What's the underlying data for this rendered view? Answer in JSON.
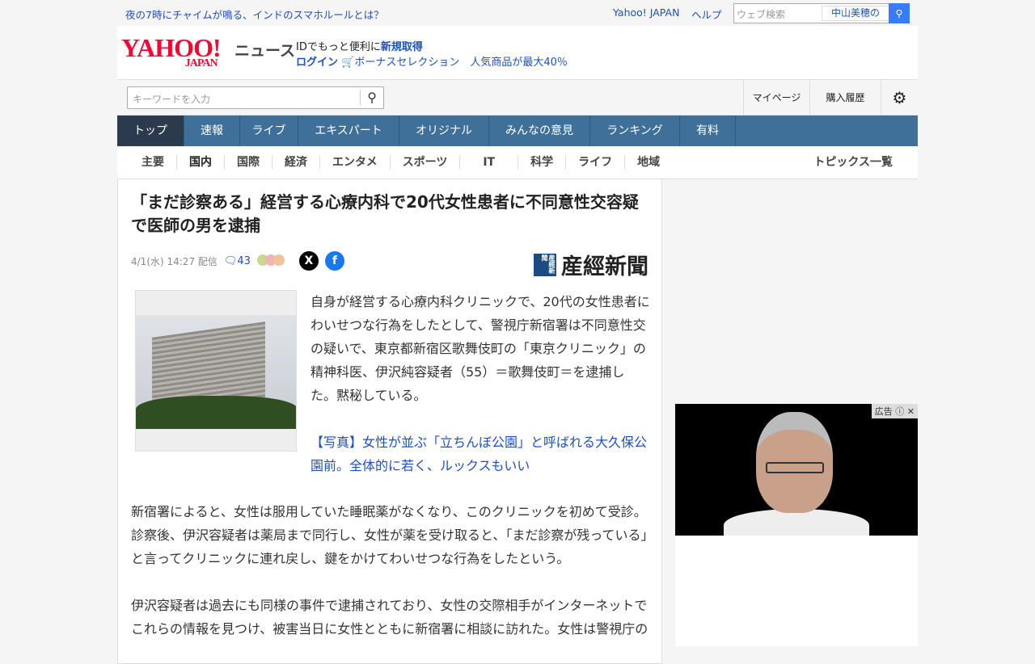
{
  "topbar": {
    "promo": "夜の7時にチャイムが鳴る、インドのスマホルールとは？",
    "yahoo_japan": "Yahoo! JAPAN",
    "help": "ヘルプ",
    "search_placeholder": "ウェブ検索",
    "suggest": "中山美穂の"
  },
  "header": {
    "logo": "YAHOO!",
    "logo_sub": "JAPAN",
    "service": "ニュース",
    "id_text": "IDでもっと便利に",
    "signup": "新規取得",
    "login": "ログイン",
    "promo": "ボーナスセレクション　人気商品が最大40％"
  },
  "searchbar": {
    "placeholder": "キーワードを入力",
    "mypage": "マイページ",
    "history": "購入履歴"
  },
  "nav": [
    "トップ",
    "速報",
    "ライブ",
    "エキスパート",
    "オリジナル",
    "みんなの意見",
    "ランキング",
    "有料"
  ],
  "subnav": [
    "主要",
    "国内",
    "国際",
    "経済",
    "エンタメ",
    "スポーツ",
    "IT",
    "科学",
    "ライフ",
    "地域"
  ],
  "subnav_all": "トピックス一覧",
  "article": {
    "title": "「まだ診察ある」経営する心療内科で20代女性患者に不同意性交容疑で医師の男を逮捕",
    "date": "4/1(水) 14:27 配信",
    "comments": "43",
    "source": "産經新聞",
    "source_badge": "産經新聞",
    "p1": "自身が経営する心療内科クリニックで、20代の女性患者にわいせつな行為をしたとして、警視庁新宿署は不同意性交の疑いで、東京都新宿区歌舞伎町の「東京クリニック」の精神科医、伊沢純容疑者（55）＝歌舞伎町＝を逮捕した。黙秘している。",
    "photo_link": "【写真】女性が並ぶ「立ちんぼ公園」と呼ばれる大久保公園前。全体的に若く、ルックスもいい",
    "p2": "新宿署によると、女性は服用していた睡眠薬がなくなり、このクリニックを初めて受診。診察後、伊沢容疑者は薬局まで同行し、女性が薬を受け取ると、「まだ診察が残っている」と言ってクリニックに連れ戻し、鍵をかけてわいせつな行為をしたという。",
    "p3": "伊沢容疑者は過去にも同様の事件で逮捕されており、女性の交際相手がインターネットでこれらの情報を見つけ、被害当日に女性とともに新宿署に相談に訪れた。女性は警視庁の"
  },
  "ad": {
    "label": "広告"
  }
}
